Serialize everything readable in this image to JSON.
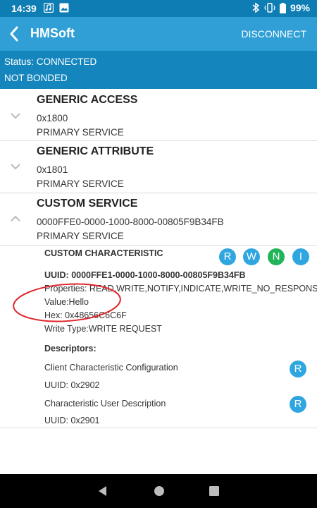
{
  "status_bar": {
    "time": "14:39",
    "battery": "99%",
    "icons": [
      "music-icon",
      "image-icon",
      "bluetooth-icon",
      "vibrate-icon",
      "battery-icon"
    ]
  },
  "app_bar": {
    "title": "HMSoft",
    "disconnect_label": "DISCONNECT"
  },
  "connection": {
    "status": "Status: CONNECTED",
    "bond": "NOT BONDED"
  },
  "services": [
    {
      "name": "GENERIC ACCESS",
      "uuid": "0x1800",
      "type": "PRIMARY SERVICE",
      "expanded": false
    },
    {
      "name": "GENERIC ATTRIBUTE",
      "uuid": "0x1801",
      "type": "PRIMARY SERVICE",
      "expanded": false
    },
    {
      "name": "CUSTOM SERVICE",
      "uuid": "0000FFE0-0000-1000-8000-00805F9B34FB",
      "type": "PRIMARY SERVICE",
      "expanded": true
    }
  ],
  "characteristic": {
    "name": "CUSTOM CHARACTERISTIC",
    "uuid": "UUID: 0000FFE1-0000-1000-8000-00805F9B34FB",
    "properties": "Properties: READ,WRITE,NOTIFY,INDICATE,WRITE_NO_RESPONS",
    "value": "Value:Hello",
    "hex": "Hex: 0x48656C6C6F",
    "write_type": "Write Type:WRITE REQUEST",
    "actions": [
      "R",
      "W",
      "N",
      "I"
    ],
    "descriptors_heading": "Descriptors:",
    "descriptors": [
      {
        "name": "Client Characteristic Configuration",
        "uuid": "UUID: 0x2902",
        "action": "R"
      },
      {
        "name": "Characteristic User Description",
        "uuid": "UUID: 0x2901",
        "action": "R"
      }
    ]
  },
  "colors": {
    "status_bar": "#0d7db4",
    "app_bar": "#2f9fd6",
    "status_block": "#1586bd",
    "badge_blue": "#2fa6df",
    "badge_green": "#22b35b",
    "annotation_red": "#e0242b"
  }
}
